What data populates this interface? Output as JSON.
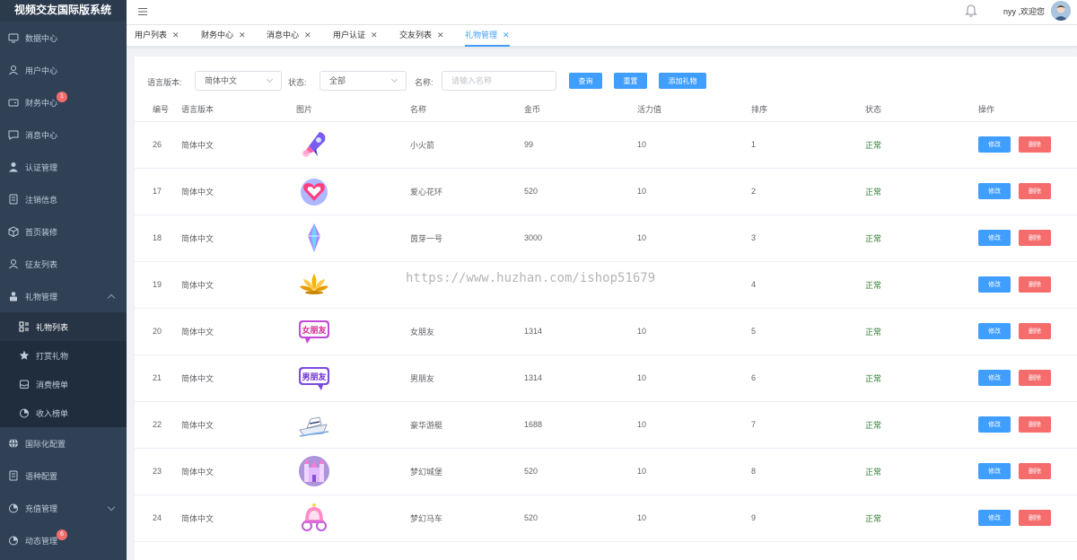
{
  "app": {
    "title": "视频交友国际版系统"
  },
  "header": {
    "greeting": "nyy ,欢迎您"
  },
  "sidebar": {
    "items": [
      {
        "label": "数据中心",
        "icon": "monitor-icon"
      },
      {
        "label": "用户中心",
        "icon": "user-outline-icon"
      },
      {
        "label": "财务中心",
        "icon": "wallet-icon",
        "badge": "1"
      },
      {
        "label": "消息中心",
        "icon": "chat-icon"
      },
      {
        "label": "认证管理",
        "icon": "user-filled-icon"
      },
      {
        "label": "注销信息",
        "icon": "document-icon"
      },
      {
        "label": "首页装修",
        "icon": "box-icon"
      },
      {
        "label": "征友列表",
        "icon": "user-outline-icon"
      },
      {
        "label": "礼物管理",
        "icon": "lock-user-icon"
      }
    ],
    "gift_sub": [
      {
        "label": "礼物列表",
        "icon": "grid-list-icon"
      },
      {
        "label": "打赏礼物",
        "icon": "star-icon"
      },
      {
        "label": "消费榜单",
        "icon": "tray-icon"
      },
      {
        "label": "收入榜单",
        "icon": "pie-chart-icon"
      }
    ],
    "items_after": [
      {
        "label": "国际化配置",
        "icon": "globe-icon"
      },
      {
        "label": "语种配置",
        "icon": "document-icon"
      },
      {
        "label": "充值管理",
        "icon": "pie-chart-icon"
      },
      {
        "label": "动态管理",
        "icon": "pie-chart-icon",
        "badge": "6"
      }
    ]
  },
  "tabs": [
    {
      "label": "用户列表"
    },
    {
      "label": "财务中心"
    },
    {
      "label": "消息中心"
    },
    {
      "label": "用户认证"
    },
    {
      "label": "交友列表"
    },
    {
      "label": "礼物管理"
    }
  ],
  "filters": {
    "language_label": "语言版本:",
    "language_value": "简体中文",
    "status_label": "状态:",
    "status_value": "全部",
    "name_label": "名称:",
    "name_placeholder": "请输入名称",
    "query_button": "查询",
    "reset_button": "重置",
    "add_button": "添加礼物"
  },
  "table": {
    "headers": [
      "编号",
      "语言版本",
      "图片",
      "名称",
      "金币",
      "活力值",
      "排序",
      "状态",
      "操作"
    ],
    "edit_label": "修改",
    "delete_label": "删除",
    "rows": [
      {
        "id": "26",
        "lang": "简体中文",
        "name": "小火箭",
        "coins": "99",
        "vitality": "10",
        "sort": "1",
        "status": "正常",
        "image_icon": "rocket-icon"
      },
      {
        "id": "17",
        "lang": "简体中文",
        "name": "爱心花环",
        "coins": "520",
        "vitality": "10",
        "sort": "2",
        "status": "正常",
        "image_icon": "heart-wreath-icon"
      },
      {
        "id": "18",
        "lang": "简体中文",
        "name": "茵芽一号",
        "coins": "3000",
        "vitality": "10",
        "sort": "3",
        "status": "正常",
        "image_icon": "crystal-icon"
      },
      {
        "id": "19",
        "lang": "简体中文",
        "name": "",
        "coins": "",
        "vitality": "",
        "sort": "4",
        "status": "正常",
        "image_icon": "lotus-icon"
      },
      {
        "id": "20",
        "lang": "简体中文",
        "name": "女朋友",
        "coins": "1314",
        "vitality": "10",
        "sort": "5",
        "status": "正常",
        "image_icon": "girlfriend-badge-icon"
      },
      {
        "id": "21",
        "lang": "简体中文",
        "name": "男朋友",
        "coins": "1314",
        "vitality": "10",
        "sort": "6",
        "status": "正常",
        "image_icon": "boyfriend-badge-icon"
      },
      {
        "id": "22",
        "lang": "简体中文",
        "name": "豪华游艇",
        "coins": "1688",
        "vitality": "10",
        "sort": "7",
        "status": "正常",
        "image_icon": "yacht-icon"
      },
      {
        "id": "23",
        "lang": "简体中文",
        "name": "梦幻城堡",
        "coins": "520",
        "vitality": "10",
        "sort": "8",
        "status": "正常",
        "image_icon": "castle-icon"
      },
      {
        "id": "24",
        "lang": "简体中文",
        "name": "梦幻马车",
        "coins": "520",
        "vitality": "10",
        "sort": "9",
        "status": "正常",
        "image_icon": "carriage-icon"
      }
    ]
  },
  "watermark": "https://www.huzhan.com/ishop51679",
  "colors": {
    "primary": "#409eff",
    "danger": "#f56c6c",
    "sidebar": "#304156",
    "status_ok": "#2e7d32"
  }
}
